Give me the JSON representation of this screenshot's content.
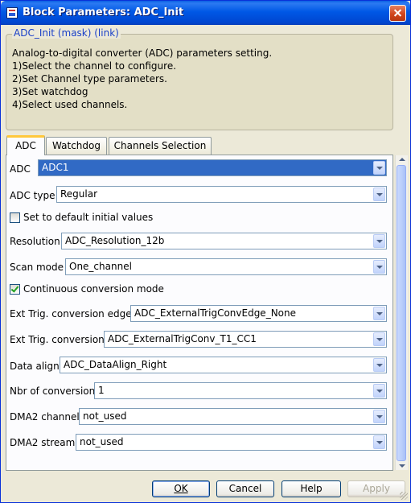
{
  "window": {
    "title": "Block Parameters: ADC_Init"
  },
  "description": {
    "legend": "ADC_Init (mask) (link)",
    "lines": [
      "Analog-to-digital converter (ADC) parameters setting.",
      "1)Select the channel to configure.",
      "2)Set Channel type parameters.",
      "3)Set watchdog",
      "4)Select used channels."
    ]
  },
  "tabs": [
    "ADC",
    "Watchdog",
    "Channels Selection"
  ],
  "params": {
    "adc": {
      "label": "ADC",
      "value": "ADC1"
    },
    "adc_type": {
      "label": "ADC type",
      "value": "Regular"
    },
    "default_values": {
      "label": "Set to default initial values",
      "checked": false
    },
    "resolution": {
      "label": "Resolution",
      "value": "ADC_Resolution_12b"
    },
    "scan_mode": {
      "label": "Scan mode",
      "value": "One_channel"
    },
    "continuous": {
      "label": "Continuous conversion mode",
      "checked": true
    },
    "ext_trig_edge": {
      "label": "Ext Trig. conversion edge",
      "value": "ADC_ExternalTrigConvEdge_None"
    },
    "ext_trig_conv": {
      "label": "Ext Trig. conversion",
      "value": "ADC_ExternalTrigConv_T1_CC1"
    },
    "data_align": {
      "label": "Data align",
      "value": "ADC_DataAlign_Right"
    },
    "nbr_conversion": {
      "label": "Nbr of conversion",
      "value": "1"
    },
    "dma2_channel": {
      "label": "DMA2 channel",
      "value": "not_used"
    },
    "dma2_stream": {
      "label": "DMA2 stream",
      "value": "not_used"
    }
  },
  "buttons": {
    "ok": "OK",
    "cancel": "Cancel",
    "help": "Help",
    "apply": "Apply"
  }
}
